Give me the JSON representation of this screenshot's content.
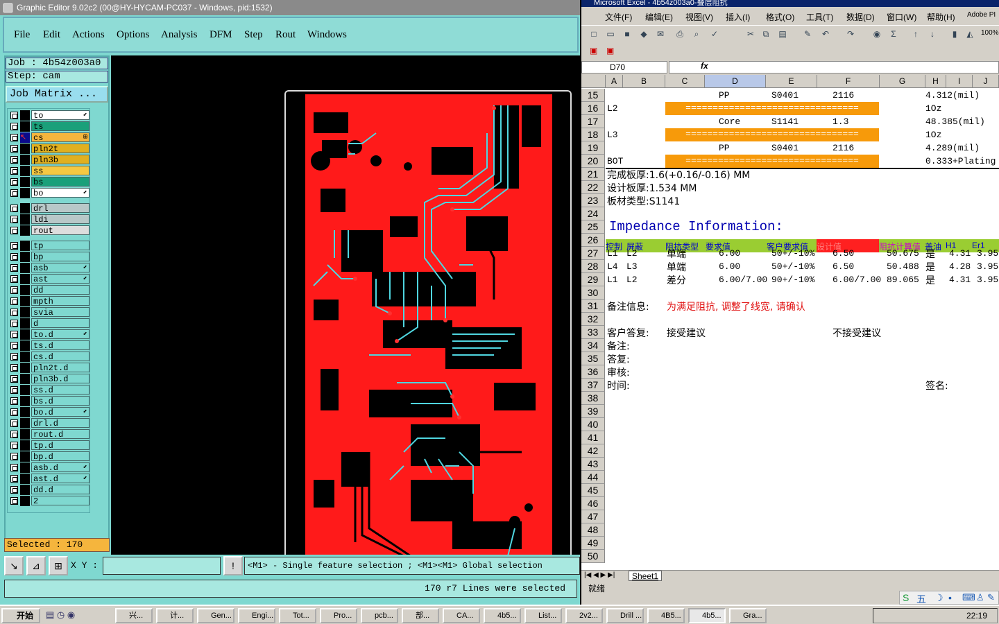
{
  "ge": {
    "title": "Graphic Editor 9.02c2 (00@HY-HYCAM-PC037 - Windows, pid:1532)",
    "menu": [
      "File",
      "Edit",
      "Actions",
      "Options",
      "Analysis",
      "DFM",
      "Step",
      "Rout",
      "Windows"
    ],
    "job": "Job : 4b54z003a0",
    "step": "Step: cam",
    "job_matrix": "Job Matrix ...",
    "layers": [
      {
        "n": "to",
        "c": "#ffffff",
        "f": "⬋"
      },
      {
        "n": "ts",
        "c": "#1aa07a",
        "f": ""
      },
      {
        "n": "cs",
        "c": "#f5b53d",
        "f": "⊞",
        "active": true
      },
      {
        "n": "pln2t",
        "c": "#e0b020",
        "f": ""
      },
      {
        "n": "pln3b",
        "c": "#e0b020",
        "f": ""
      },
      {
        "n": "ss",
        "c": "#f5c842",
        "f": ""
      },
      {
        "n": "bs",
        "c": "#1aa07a",
        "f": ""
      },
      {
        "n": "bo",
        "c": "#ffffff",
        "f": "⬋"
      },
      {
        "n": "drl",
        "c": "#b8c8c8",
        "f": ""
      },
      {
        "n": "ldi",
        "c": "#b8c8c8",
        "f": ""
      },
      {
        "n": "rout",
        "c": "#dddddd",
        "f": ""
      },
      {
        "n": "tp",
        "c": "#7fd8d0",
        "f": ""
      },
      {
        "n": "bp",
        "c": "#7fd8d0",
        "f": ""
      },
      {
        "n": "asb",
        "c": "#7fd8d0",
        "f": "⬋"
      },
      {
        "n": "ast",
        "c": "#7fd8d0",
        "f": "⬋"
      },
      {
        "n": "dd",
        "c": "#7fd8d0",
        "f": ""
      },
      {
        "n": "mpth",
        "c": "#7fd8d0",
        "f": ""
      },
      {
        "n": "svia",
        "c": "#7fd8d0",
        "f": ""
      },
      {
        "n": "d",
        "c": "#7fd8d0",
        "f": ""
      },
      {
        "n": "to.d",
        "c": "#7fd8d0",
        "f": "⬋"
      },
      {
        "n": "ts.d",
        "c": "#7fd8d0",
        "f": ""
      },
      {
        "n": "cs.d",
        "c": "#7fd8d0",
        "f": ""
      },
      {
        "n": "pln2t.d",
        "c": "#7fd8d0",
        "f": ""
      },
      {
        "n": "pln3b.d",
        "c": "#7fd8d0",
        "f": ""
      },
      {
        "n": "ss.d",
        "c": "#7fd8d0",
        "f": ""
      },
      {
        "n": "bs.d",
        "c": "#7fd8d0",
        "f": ""
      },
      {
        "n": "bo.d",
        "c": "#7fd8d0",
        "f": "⬋"
      },
      {
        "n": "drl.d",
        "c": "#7fd8d0",
        "f": ""
      },
      {
        "n": "rout.d",
        "c": "#7fd8d0",
        "f": ""
      },
      {
        "n": "tp.d",
        "c": "#7fd8d0",
        "f": ""
      },
      {
        "n": "bp.d",
        "c": "#7fd8d0",
        "f": ""
      },
      {
        "n": "asb.d",
        "c": "#7fd8d0",
        "f": "⬋"
      },
      {
        "n": "ast.d",
        "c": "#7fd8d0",
        "f": "⬋"
      },
      {
        "n": "dd.d",
        "c": "#7fd8d0",
        "f": ""
      },
      {
        "n": "2",
        "c": "#7fd8d0",
        "f": ""
      }
    ],
    "selected": "Selected : 170",
    "xy_label": "X Y :",
    "xy_value": "",
    "hint": "<M1> - Single feature selection ; <M1><M1> Global selection",
    "status": "170 r7 Lines were selected",
    "colors": {
      "copper": "#ff1a1a",
      "trace": "#4fd6e0"
    }
  },
  "xl": {
    "title": "Microsoft Excel - 4b54z003a0-叠层阻抗",
    "menu": [
      "文件(F)",
      "编辑(E)",
      "视图(V)",
      "插入(I)",
      "格式(O)",
      "工具(T)",
      "数据(D)",
      "窗口(W)",
      "帮助(H)",
      "Adobe PI"
    ],
    "zoom": "100%",
    "namebox": "D70",
    "cols": [
      "A",
      "B",
      "C",
      "D",
      "E",
      "F",
      "G",
      "H",
      "I",
      "J"
    ],
    "rows": [
      {
        "r": "15",
        "cells": [
          {
            "col": "D",
            "t": "PP"
          },
          {
            "col": "E",
            "t": "S0401"
          },
          {
            "col": "F",
            "t": "2116"
          },
          {
            "col": "H",
            "t": "4.312(mil)"
          }
        ]
      },
      {
        "r": "16",
        "cells": [
          {
            "col": "A",
            "t": "L2"
          },
          {
            "col": "H",
            "t": "1Oz"
          }
        ],
        "bar": "================================"
      },
      {
        "r": "17",
        "cells": [
          {
            "col": "D",
            "t": "Core"
          },
          {
            "col": "E",
            "t": "S1141"
          },
          {
            "col": "F",
            "t": "1.3"
          },
          {
            "col": "H",
            "t": "48.385(mil)"
          }
        ]
      },
      {
        "r": "18",
        "cells": [
          {
            "col": "A",
            "t": "L3"
          },
          {
            "col": "H",
            "t": "1Oz"
          }
        ],
        "bar": "================================"
      },
      {
        "r": "19",
        "cells": [
          {
            "col": "D",
            "t": "PP"
          },
          {
            "col": "E",
            "t": "S0401"
          },
          {
            "col": "F",
            "t": "2116"
          },
          {
            "col": "H",
            "t": "4.289(mil)"
          }
        ]
      },
      {
        "r": "20",
        "cells": [
          {
            "col": "A",
            "t": "BOT"
          },
          {
            "col": "H",
            "t": "0.333+Plating"
          }
        ],
        "bar": "================================"
      },
      {
        "r": "21",
        "cells": [
          {
            "col": "A",
            "t": "完成板厚:1.6(+0.16/-0.16) MM"
          }
        ]
      },
      {
        "r": "22",
        "cells": [
          {
            "col": "A",
            "t": "设计板厚:1.534 MM"
          }
        ]
      },
      {
        "r": "23",
        "cells": [
          {
            "col": "A",
            "t": "板材类型:S1141"
          }
        ]
      },
      {
        "r": "24",
        "cells": []
      },
      {
        "r": "25",
        "cells": [
          {
            "col": "A",
            "t": "Impedance  Information:",
            "big": true
          }
        ]
      },
      {
        "r": "26",
        "cells": []
      },
      {
        "r": "27",
        "cells": [
          {
            "col": "A",
            "t": "L1"
          },
          {
            "col": "B",
            "t": "L2"
          },
          {
            "col": "C",
            "t": "单端"
          },
          {
            "col": "D",
            "t": "6.00"
          },
          {
            "col": "E",
            "t": "50+/-10%"
          },
          {
            "col": "F",
            "t": "6.50"
          },
          {
            "col": "G",
            "t": "50.675"
          },
          {
            "col": "H",
            "t": "是"
          },
          {
            "col": "I",
            "t": "4.31"
          },
          {
            "col": "J",
            "t": "3.95"
          }
        ]
      },
      {
        "r": "28",
        "cells": [
          {
            "col": "A",
            "t": "L4"
          },
          {
            "col": "B",
            "t": "L3"
          },
          {
            "col": "C",
            "t": "单端"
          },
          {
            "col": "D",
            "t": "6.00"
          },
          {
            "col": "E",
            "t": "50+/-10%"
          },
          {
            "col": "F",
            "t": "6.50"
          },
          {
            "col": "G",
            "t": "50.488"
          },
          {
            "col": "H",
            "t": "是"
          },
          {
            "col": "I",
            "t": "4.28"
          },
          {
            "col": "J",
            "t": "3.95"
          }
        ]
      },
      {
        "r": "29",
        "cells": [
          {
            "col": "A",
            "t": "L1"
          },
          {
            "col": "B",
            "t": "L2"
          },
          {
            "col": "C",
            "t": "差分"
          },
          {
            "col": "D",
            "t": "6.00/7.00"
          },
          {
            "col": "E",
            "t": "90+/-10%"
          },
          {
            "col": "F",
            "t": "6.00/7.00"
          },
          {
            "col": "G",
            "t": "89.065"
          },
          {
            "col": "H",
            "t": "是"
          },
          {
            "col": "I",
            "t": "4.31"
          },
          {
            "col": "J",
            "t": "3.95"
          }
        ]
      },
      {
        "r": "30",
        "cells": []
      },
      {
        "r": "31",
        "cells": [
          {
            "col": "A",
            "t": "备注信息:"
          },
          {
            "col": "C",
            "t": "为满足阻抗, 调整了线宽, 请确认",
            "red": true
          }
        ]
      },
      {
        "r": "32",
        "cells": []
      },
      {
        "r": "33",
        "cells": [
          {
            "col": "A",
            "t": "客户答复:"
          },
          {
            "col": "C",
            "t": "接受建议"
          },
          {
            "col": "F",
            "t": "不接受建议"
          }
        ]
      },
      {
        "r": "34",
        "cells": [
          {
            "col": "A",
            "t": "备注:"
          }
        ]
      },
      {
        "r": "35",
        "cells": [
          {
            "col": "A",
            "t": "答复:"
          }
        ]
      },
      {
        "r": "36",
        "cells": [
          {
            "col": "A",
            "t": "审核:"
          }
        ]
      },
      {
        "r": "37",
        "cells": [
          {
            "col": "A",
            "t": "时间:"
          },
          {
            "col": "H",
            "t": "签名:"
          }
        ]
      },
      {
        "r": "38",
        "cells": []
      },
      {
        "r": "39",
        "cells": []
      },
      {
        "r": "40",
        "cells": []
      },
      {
        "r": "41",
        "cells": []
      },
      {
        "r": "42",
        "cells": []
      },
      {
        "r": "43",
        "cells": []
      },
      {
        "r": "44",
        "cells": []
      },
      {
        "r": "45",
        "cells": []
      },
      {
        "r": "46",
        "cells": []
      },
      {
        "r": "47",
        "cells": []
      },
      {
        "r": "48",
        "cells": []
      },
      {
        "r": "49",
        "cells": []
      },
      {
        "r": "50",
        "cells": []
      }
    ],
    "hdr26": [
      {
        "t": "控制",
        "c": "#0000cc"
      },
      {
        "t": "屏蔽",
        "c": "#0000cc"
      },
      {
        "t": "阻抗类型",
        "c": "#0000cc"
      },
      {
        "t": "要求值",
        "c": "#0000cc"
      },
      {
        "t": "客户要求值",
        "c": "#0000cc"
      },
      {
        "t": "设计值",
        "c": "#ff3030"
      },
      {
        "t": "阻抗计算值",
        "c": "#cc00cc"
      },
      {
        "t": "盖油",
        "c": "#0000cc"
      },
      {
        "t": "H1",
        "c": "#0000cc"
      },
      {
        "t": "Er1",
        "c": "#0000cc"
      }
    ],
    "sheet": "Sheet1",
    "status": "就绪"
  },
  "taskbar": {
    "start": "开始",
    "tasks": [
      "兴...",
      "计...",
      "Gen...",
      "Engi...",
      "Tot...",
      "Pro...",
      "pcb...",
      "部...",
      "CA...",
      "4b5...",
      "List...",
      "2v2...",
      "Drill ...",
      "4B5...",
      "4b5...",
      "Gra..."
    ],
    "clock": "22:19"
  }
}
